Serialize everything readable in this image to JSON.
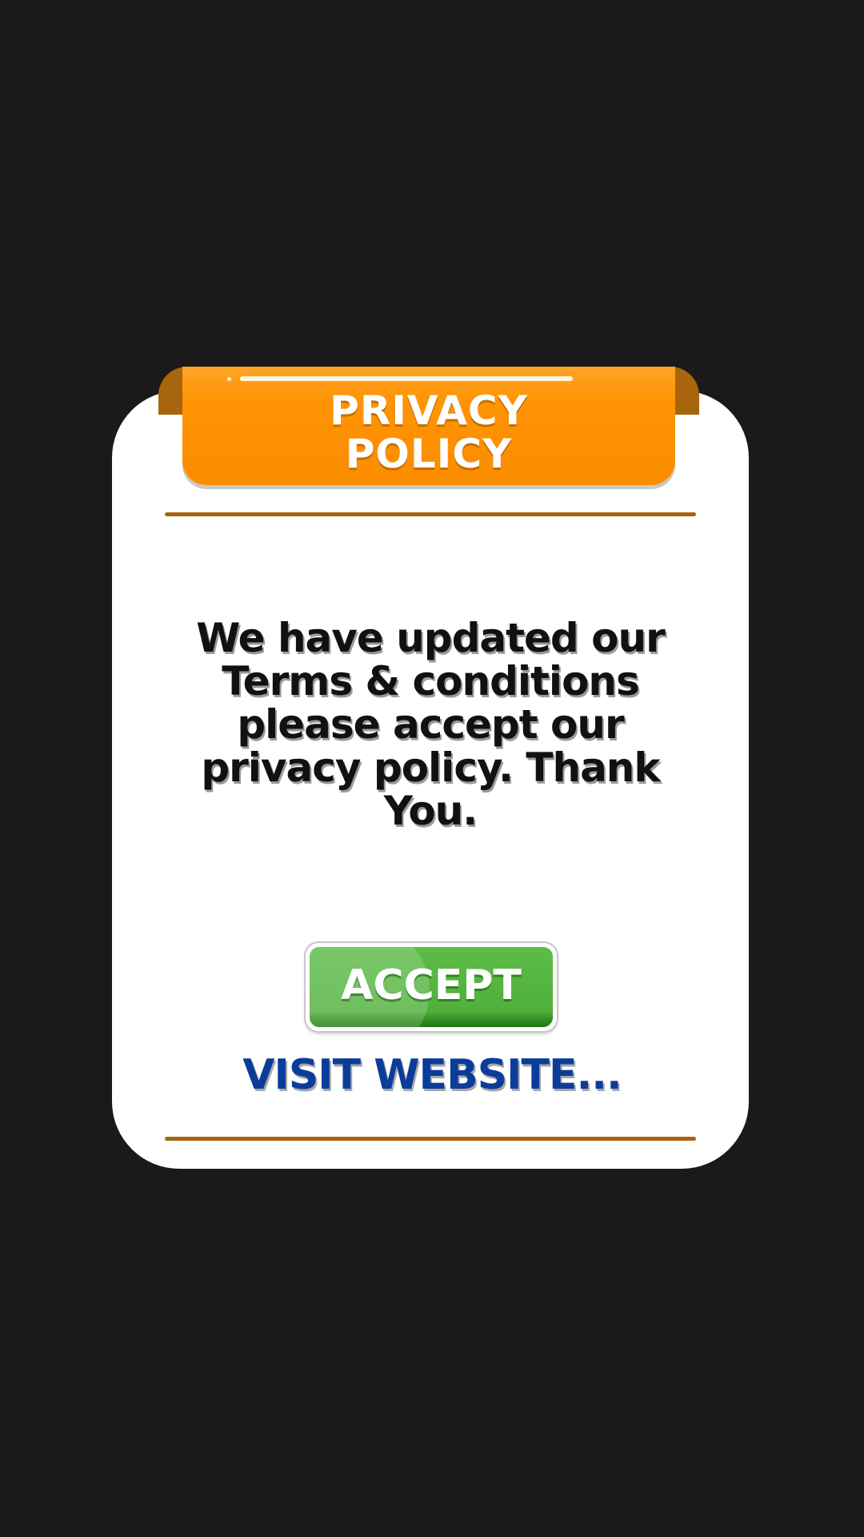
{
  "dialog": {
    "title": "PRIVACY\nPOLICY",
    "message": "We have updated our Terms & conditions please accept our privacy policy. Thank You.",
    "accept_label": "ACCEPT",
    "visit_label": "VISIT WEBSITE..."
  },
  "colors": {
    "background": "#1a1a1a",
    "card": "#ffffff",
    "ribbon": "#ff9303",
    "ribbon_fold": "#a8650d",
    "divider": "#a8650d",
    "accept_button": "#51b03c",
    "visit_link": "#0a3d9a"
  }
}
